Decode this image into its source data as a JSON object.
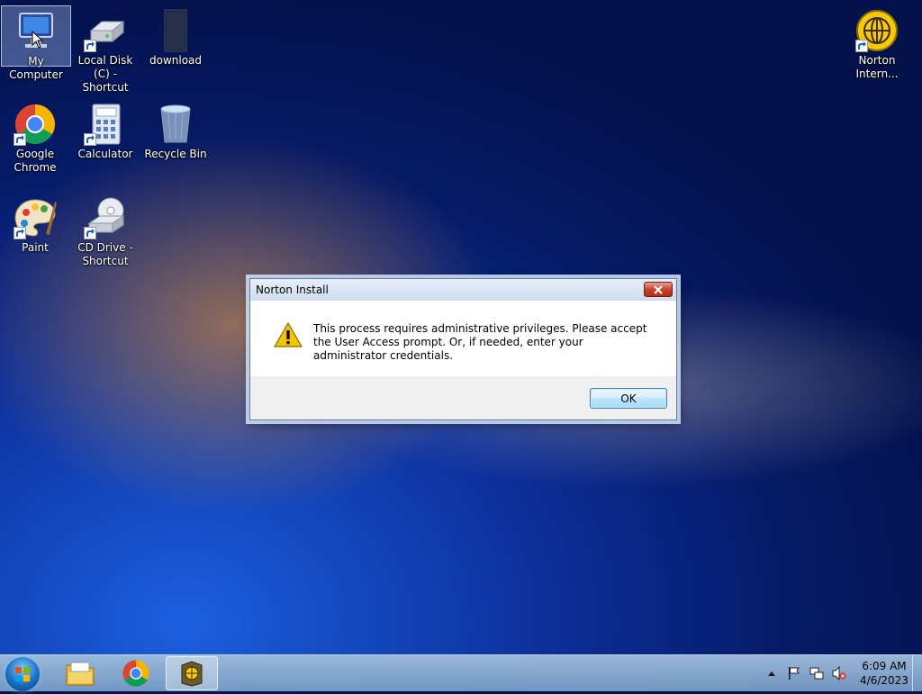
{
  "desktop": {
    "icons": [
      {
        "label": "My Computer"
      },
      {
        "label": "Local Disk (C) - Shortcut"
      },
      {
        "label": "download"
      },
      {
        "label": "Google Chrome"
      },
      {
        "label": "Calculator"
      },
      {
        "label": "Recycle Bin"
      },
      {
        "label": "Paint"
      },
      {
        "label": "CD Drive - Shortcut"
      },
      {
        "label": "Norton Intern..."
      }
    ]
  },
  "dialog": {
    "title": "Norton Install",
    "message": "This process requires administrative privileges. Please accept the User Access prompt. Or, if needed, enter your administrator credentials.",
    "ok_label": "OK",
    "icon": "warning-icon"
  },
  "taskbar": {
    "items": [
      "start-orb",
      "file-explorer-icon",
      "chrome-icon",
      "norton-installer-icon"
    ],
    "clock": {
      "time": "6:09 AM",
      "date": "4/6/2023"
    },
    "tray": [
      "show-hidden-icons",
      "action-center-flag-icon",
      "network-icon",
      "volume-muted-icon"
    ]
  },
  "colors": {
    "accent": "#3c7fb1",
    "warning": "#f5c400",
    "close": "#c7452c"
  }
}
